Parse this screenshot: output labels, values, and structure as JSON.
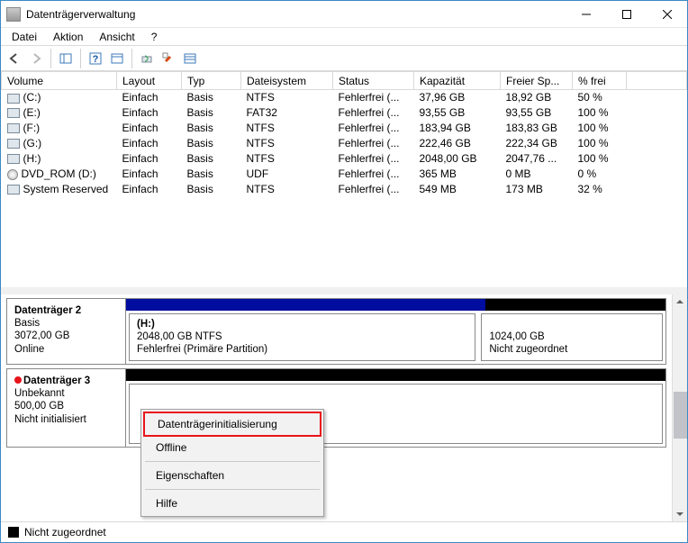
{
  "window": {
    "title": "Datenträgerverwaltung"
  },
  "menus": {
    "file": "Datei",
    "action": "Aktion",
    "view": "Ansicht",
    "help": "?"
  },
  "table": {
    "headers": {
      "volume": "Volume",
      "layout": "Layout",
      "type": "Typ",
      "filesystem": "Dateisystem",
      "status": "Status",
      "capacity": "Kapazität",
      "free": "Freier Sp...",
      "pct": "% frei"
    },
    "rows": [
      {
        "icon": "hdd",
        "volume": "(C:)",
        "layout": "Einfach",
        "type": "Basis",
        "fs": "NTFS",
        "status": "Fehlerfrei (...",
        "cap": "37,96 GB",
        "free": "18,92 GB",
        "pct": "50 %"
      },
      {
        "icon": "hdd",
        "volume": "(E:)",
        "layout": "Einfach",
        "type": "Basis",
        "fs": "FAT32",
        "status": "Fehlerfrei (...",
        "cap": "93,55 GB",
        "free": "93,55 GB",
        "pct": "100 %"
      },
      {
        "icon": "hdd",
        "volume": "(F:)",
        "layout": "Einfach",
        "type": "Basis",
        "fs": "NTFS",
        "status": "Fehlerfrei (...",
        "cap": "183,94 GB",
        "free": "183,83 GB",
        "pct": "100 %"
      },
      {
        "icon": "hdd",
        "volume": "(G:)",
        "layout": "Einfach",
        "type": "Basis",
        "fs": "NTFS",
        "status": "Fehlerfrei (...",
        "cap": "222,46 GB",
        "free": "222,34 GB",
        "pct": "100 %"
      },
      {
        "icon": "hdd",
        "volume": "(H:)",
        "layout": "Einfach",
        "type": "Basis",
        "fs": "NTFS",
        "status": "Fehlerfrei (...",
        "cap": "2048,00 GB",
        "free": "2047,76 ...",
        "pct": "100 %"
      },
      {
        "icon": "dvd",
        "volume": "DVD_ROM (D:)",
        "layout": "Einfach",
        "type": "Basis",
        "fs": "UDF",
        "status": "Fehlerfrei (...",
        "cap": "365 MB",
        "free": "0 MB",
        "pct": "0 %"
      },
      {
        "icon": "hdd",
        "volume": "System Reserved",
        "layout": "Einfach",
        "type": "Basis",
        "fs": "NTFS",
        "status": "Fehlerfrei (...",
        "cap": "549 MB",
        "free": "173 MB",
        "pct": "32 %"
      }
    ]
  },
  "disks": {
    "d2": {
      "name": "Datenträger 2",
      "type": "Basis",
      "size": "3072,00 GB",
      "state": "Online",
      "p1": {
        "name": "(H:)",
        "line2": "2048,00 GB NTFS",
        "line3": "Fehlerfrei (Primäre Partition)",
        "barColor": "#000d9e"
      },
      "p2": {
        "line2": "1024,00 GB",
        "line3": "Nicht zugeordnet",
        "barColor": "#000000"
      }
    },
    "d3": {
      "name": "Datenträger 3",
      "type": "Unbekannt",
      "size": "500,00 GB",
      "state": "Nicht initialisiert",
      "barColor": "#000000"
    }
  },
  "legend": {
    "unalloc": "Nicht zugeordnet"
  },
  "context_menu": {
    "init": "Datenträgerinitialisierung",
    "offline": "Offline",
    "props": "Eigenschaften",
    "help": "Hilfe"
  }
}
